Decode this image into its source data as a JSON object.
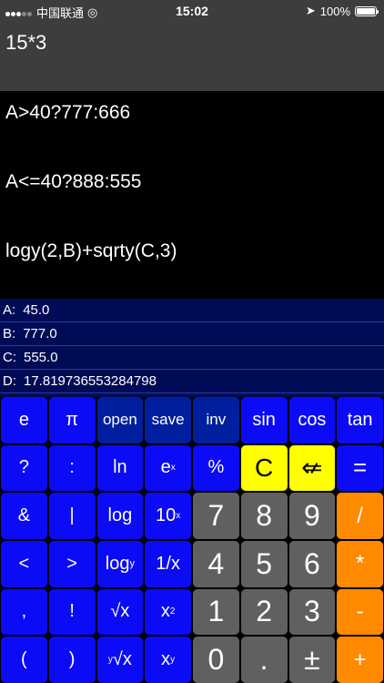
{
  "status": {
    "carrier": "中国联通",
    "time": "15:02",
    "battery": "100%"
  },
  "input": {
    "expression": "15*3"
  },
  "formulas": [
    "A>40?777:666",
    "A<=40?888:555",
    "logy(2,B)+sqrty(C,3)"
  ],
  "variables": [
    {
      "name": "A:",
      "value": "45.0"
    },
    {
      "name": "B:",
      "value": "777.0"
    },
    {
      "name": "C:",
      "value": "555.0"
    },
    {
      "name": "D:",
      "value": "17.819736553284798"
    }
  ],
  "keys": {
    "e": "e",
    "pi": "π",
    "open": "open",
    "save": "save",
    "inv": "inv",
    "sin": "sin",
    "cos": "cos",
    "tan": "tan",
    "question": "?",
    "colon": ":",
    "ln": "ln",
    "exp_base": "e",
    "exp_sup": "x",
    "percent": "%",
    "clear": "C",
    "backspace": "⇍",
    "equals": "=",
    "amp": "&",
    "pipe": "|",
    "log": "log",
    "ten_base": "10",
    "ten_sup": "x",
    "seven": "7",
    "eight": "8",
    "nine": "9",
    "divide": "/",
    "lt": "<",
    "gt": ">",
    "logy_base": "log",
    "logy_sub": "y",
    "reciprocal": "1/x",
    "four": "4",
    "five": "5",
    "six": "6",
    "multiply": "*",
    "comma": ",",
    "bang": "!",
    "sqrt": "√x",
    "sq_base": "x",
    "sq_sup": "2",
    "one": "1",
    "two": "2",
    "three": "3",
    "minus": "-",
    "lparen": "(",
    "rparen": ")",
    "yroot_sup": "y",
    "yroot_base": "√x",
    "pow_base": "x",
    "pow_sup": "y",
    "zero": "0",
    "dot": ".",
    "plusminus": "±",
    "plus": "+"
  }
}
